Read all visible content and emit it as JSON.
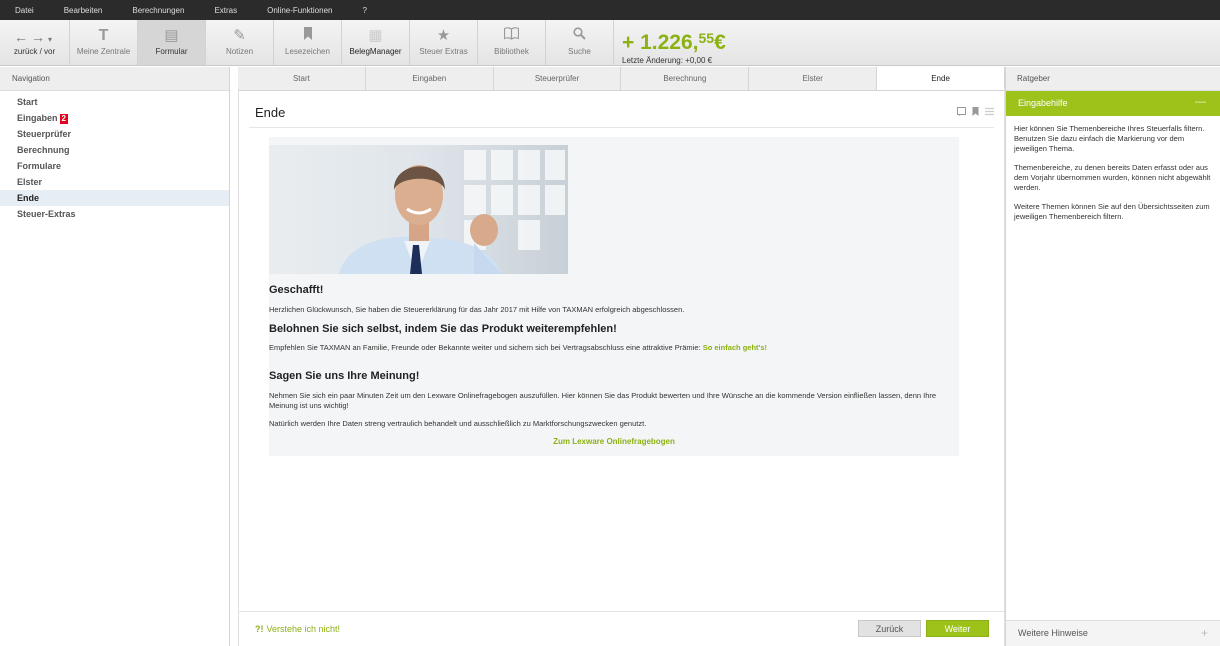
{
  "menu": [
    "Datei",
    "Bearbeiten",
    "Berechnungen",
    "Extras",
    "Online-Funktionen",
    "?"
  ],
  "toolbar": {
    "back_label": "zurück / vor",
    "items": [
      {
        "label": "Meine Zentrale",
        "icon": "T"
      },
      {
        "label": "Formular",
        "icon": "▤"
      },
      {
        "label": "Notizen",
        "icon": "✎"
      },
      {
        "label": "Lesezeichen",
        "icon": "🔖"
      },
      {
        "label": "BelegManager",
        "icon": "▦"
      },
      {
        "label": "Steuer Extras",
        "icon": "★"
      },
      {
        "label": "Bibliothek",
        "icon": "📖"
      },
      {
        "label": "Suche",
        "icon": "🔍"
      }
    ],
    "amount_main": "+ 1.226,",
    "amount_cents": "55",
    "amount_currency": "€",
    "last_change": "Letzte Änderung: +0,00 €"
  },
  "nav": {
    "header": "Navigation",
    "items": [
      "Start",
      "Eingaben",
      "Steuerprüfer",
      "Berechnung",
      "Formulare",
      "Elster",
      "Ende",
      "Steuer-Extras"
    ],
    "badge": "2"
  },
  "tabs": [
    "Start",
    "Eingaben",
    "Steuerprüfer",
    "Berechnung",
    "Elster",
    "Ende"
  ],
  "main": {
    "title": "Ende",
    "h1": "Geschafft!",
    "p1": "Herzlichen Glückwunsch, Sie haben die Steuererklärung für das Jahr 2017 mit Hilfe von TAXMAN erfolgreich abgeschlossen.",
    "h2": "Belohnen Sie sich selbst, indem Sie das Produkt weiterempfehlen!",
    "p2": "Empfehlen Sie TAXMAN an Familie, Freunde oder Bekannte weiter und sichern sich bei Vertragsabschluss eine attraktive Prämie:",
    "p2_link": "So einfach geht's!",
    "h3": "Sagen Sie uns Ihre Meinung!",
    "p3": "Nehmen Sie sich ein paar Minuten Zeit um den Lexware Onlinefragebogen auszufüllen. Hier können Sie das Produkt bewerten und Ihre Wünsche an die kommende Version einfließen lassen, denn Ihre Meinung ist uns wichtig!",
    "p4": "Natürlich werden Ihre Daten streng vertraulich behandelt und ausschließlich zu Marktforschungszwecken genutzt.",
    "survey_link": "Zum Lexware Onlinefragebogen"
  },
  "footer": {
    "help": "Verstehe ich nicht!",
    "back": "Zurück",
    "next": "Weiter"
  },
  "right": {
    "header": "Ratgeber",
    "panel_title": "Eingabehilfe",
    "paragraphs": [
      "Hier können Sie Themenbereiche Ihres Steuerfalls filtern. Benutzen Sie dazu einfach die Markierung vor dem jeweiligen Thema.",
      "Themenbereiche, zu denen bereits Daten erfasst oder aus dem Vorjahr übernommen wurden, können nicht abgewählt werden.",
      "Weitere Themen können Sie auf den Übersichtsseiten zum jeweiligen Themenbereich filtern."
    ],
    "more": "Weitere Hinweise"
  },
  "colors": {
    "accent": "#9dc21a",
    "menubar": "#2b2b2b",
    "badge": "#e3001b"
  }
}
